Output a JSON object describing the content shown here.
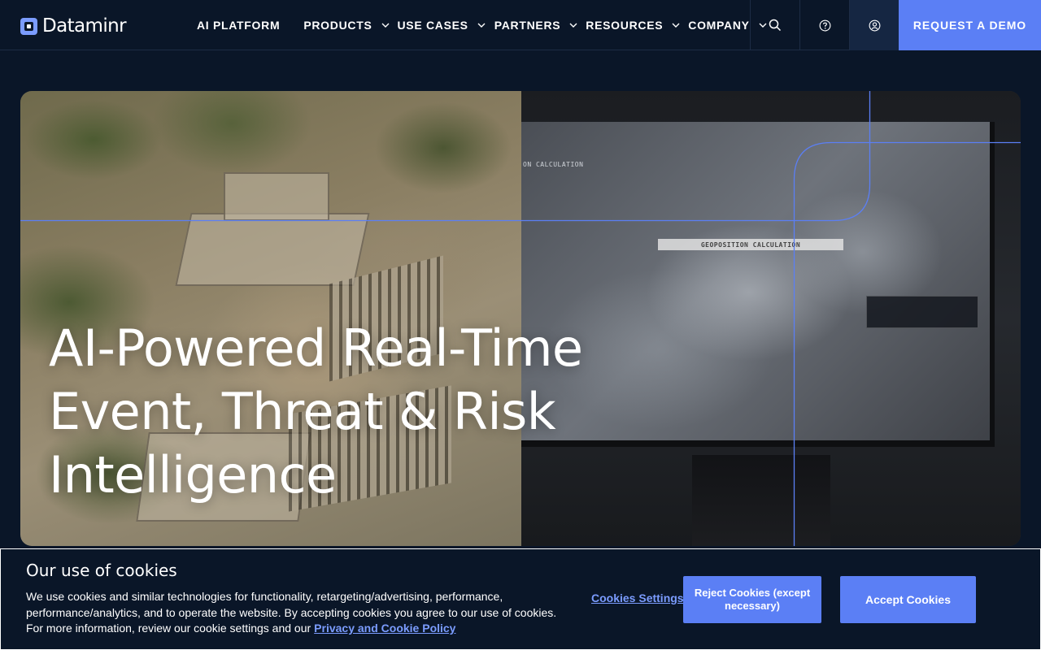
{
  "brand": {
    "name": "Dataminr",
    "icon": "dataminr-logo-icon"
  },
  "nav": {
    "items": [
      {
        "label": "AI PLATFORM",
        "has_dropdown": false
      },
      {
        "label": "PRODUCTS",
        "has_dropdown": true
      },
      {
        "label": "USE CASES",
        "has_dropdown": true
      },
      {
        "label": "PARTNERS",
        "has_dropdown": true
      },
      {
        "label": "RESOURCES",
        "has_dropdown": true
      },
      {
        "label": "COMPANY",
        "has_dropdown": true
      }
    ],
    "icons": [
      "search-icon",
      "help-icon",
      "account-icon"
    ],
    "cta_label": "REQUEST A DEMO"
  },
  "hero": {
    "title": "AI-Powered Real-Time Event, Threat & Risk Intelligence",
    "screen_label_1": "GEOPOSITION CALCULATION",
    "screen_label_2": "ON CALCULATION"
  },
  "cookie": {
    "title": "Our use of cookies",
    "text": "We use cookies and similar technologies for functionality, retargeting/advertising, performance, performance/analytics, and to operate the website. By accepting cookies you agree to our use of cookies. For more information, review our cookie settings and our",
    "policy_link": "Privacy and Cookie Policy",
    "settings_label": "Cookies Settings",
    "reject_label": "Reject Cookies (except necessary)",
    "accept_label": "Accept Cookies"
  },
  "colors": {
    "background": "#0a1628",
    "accent": "#5b7ff5",
    "link": "#7b9cff",
    "hero_lines": "#5b7ff5"
  }
}
